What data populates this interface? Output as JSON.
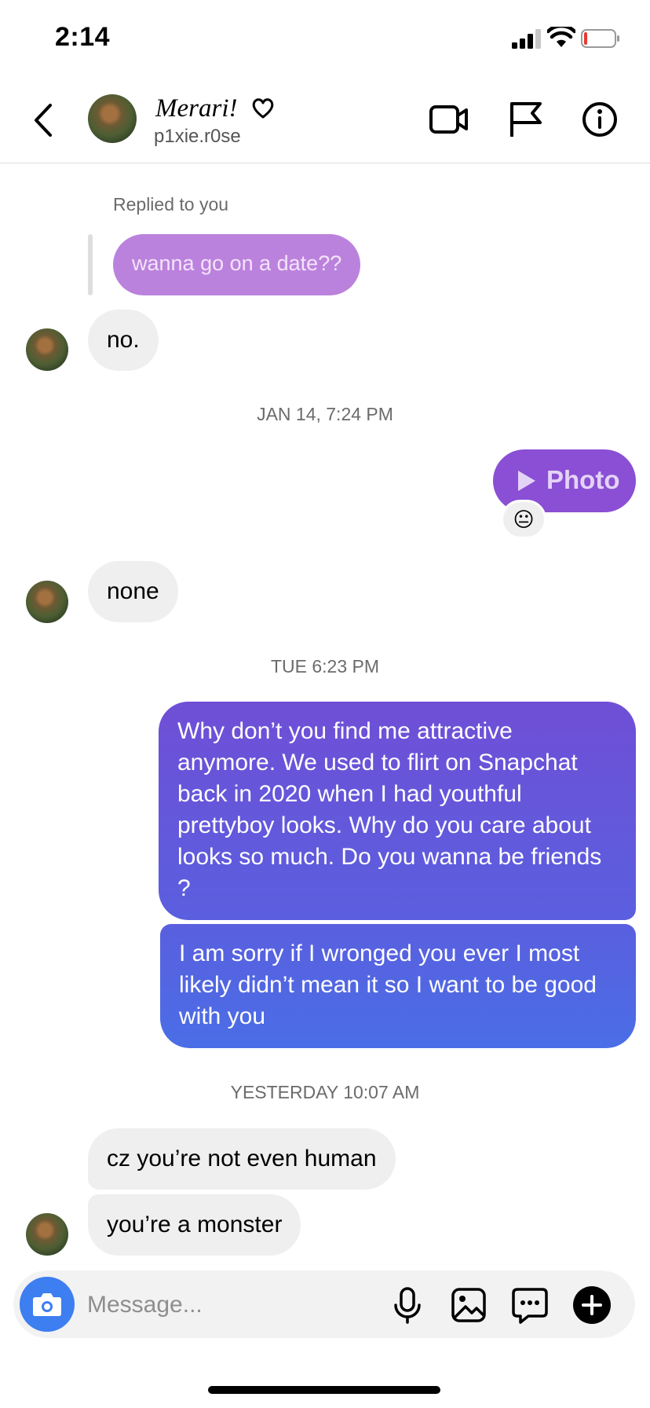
{
  "status": {
    "time": "2:14"
  },
  "header": {
    "contact_name": "Merari!",
    "username": "p1xie.r0se"
  },
  "messages": {
    "replied_label": "Replied to you",
    "reply_quote": "wanna go on a date??",
    "m1": "no.",
    "ts1": "JAN 14, 7:24 PM",
    "photo_label": "Photo",
    "photo_reaction": "😐",
    "m2": "none",
    "ts2": "TUE 6:23 PM",
    "m3": "Why don’t you find me attractive anymore. We used to flirt on Snapchat back in 2020 when I had youthful prettyboy looks. Why do you care about looks so much. Do you wanna be friends ?",
    "m4": "I am sorry if I wronged you ever I most likely didn’t mean it so I want to be good with you",
    "ts3": "YESTERDAY 10:07 AM",
    "m5": "cz you’re not even human",
    "m6": "you’re a monster"
  },
  "composer": {
    "placeholder": "Message..."
  },
  "colors": {
    "out_gradient_top": "#6f4fd6",
    "out_gradient_bottom": "#4a6ee6",
    "reply_quote": "#bb82dd",
    "photo_bubble": "#8a4fd4",
    "camera_button": "#3d7ef0",
    "incoming_bubble": "#efefef"
  },
  "icons": [
    "signal-icon",
    "wifi-icon",
    "battery-icon",
    "back-icon",
    "heart-icon",
    "video-call-icon",
    "flag-icon",
    "info-icon",
    "play-icon",
    "camera-icon",
    "microphone-icon",
    "gallery-icon",
    "sticker-icon",
    "plus-icon"
  ]
}
